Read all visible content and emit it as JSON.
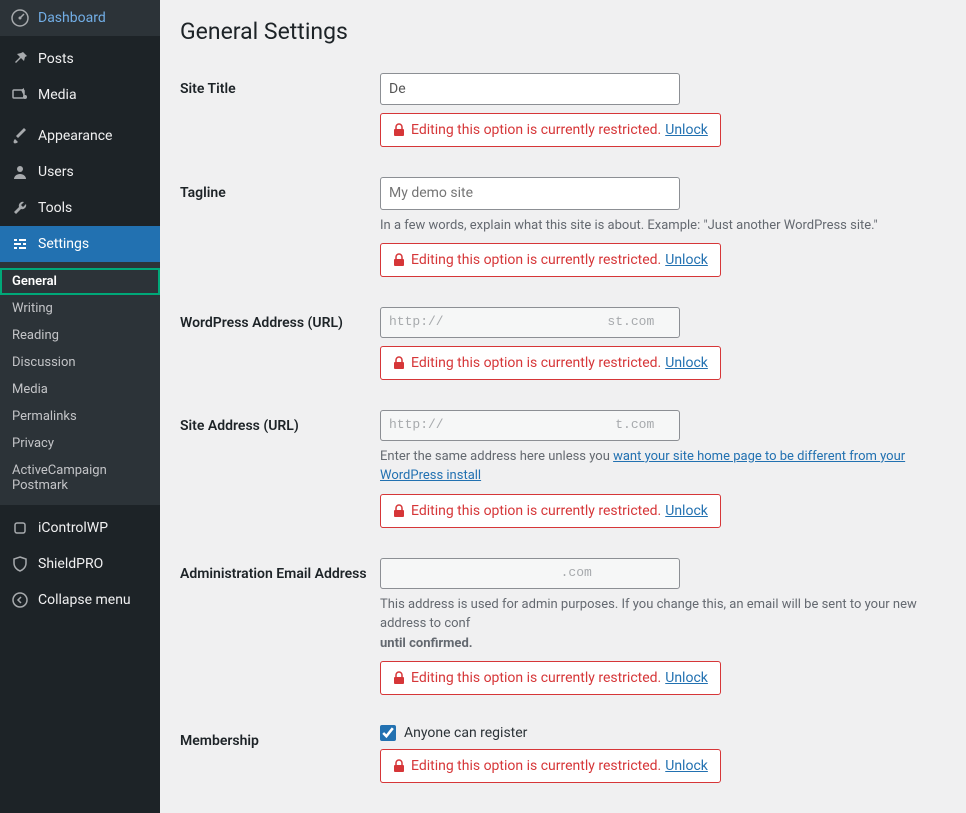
{
  "sidebar": {
    "items": [
      {
        "label": "Dashboard",
        "icon": "dashboard"
      },
      {
        "label": "Posts",
        "icon": "pin"
      },
      {
        "label": "Media",
        "icon": "media"
      },
      {
        "label": "Appearance",
        "icon": "brush"
      },
      {
        "label": "Users",
        "icon": "user"
      },
      {
        "label": "Tools",
        "icon": "wrench"
      },
      {
        "label": "Settings",
        "icon": "sliders"
      },
      {
        "label": "iControlWP",
        "icon": "plugin"
      },
      {
        "label": "ShieldPRO",
        "icon": "shield"
      },
      {
        "label": "Collapse menu",
        "icon": "collapse"
      }
    ],
    "submenu": [
      {
        "label": "General"
      },
      {
        "label": "Writing"
      },
      {
        "label": "Reading"
      },
      {
        "label": "Discussion"
      },
      {
        "label": "Media"
      },
      {
        "label": "Permalinks"
      },
      {
        "label": "Privacy"
      },
      {
        "label": "ActiveCampaign Postmark"
      }
    ]
  },
  "page": {
    "title": "General Settings"
  },
  "fields": {
    "site_title": {
      "label": "Site Title",
      "value": "De"
    },
    "tagline": {
      "label": "Tagline",
      "placeholder": "My demo site",
      "description": "In a few words, explain what this site is about. Example: \"Just another WordPress site.\""
    },
    "wp_url": {
      "label": "WordPress Address (URL)",
      "value": "http://                     st.com"
    },
    "site_url": {
      "label": "Site Address (URL)",
      "value": "http://                      t.com",
      "description_pre": "Enter the same address here unless you ",
      "description_link": "want your site home page to be different from your WordPress install"
    },
    "admin_email": {
      "label": "Administration Email Address",
      "value": "                      .com",
      "description_pre": "This address is used for admin purposes. If you change this, an email will be sent to your new address to conf",
      "description_strong": "until confirmed."
    },
    "membership": {
      "label": "Membership",
      "checkbox_label": "Anyone can register"
    }
  },
  "notice": {
    "text": "Editing this option is currently restricted.",
    "link": "Unlock"
  }
}
